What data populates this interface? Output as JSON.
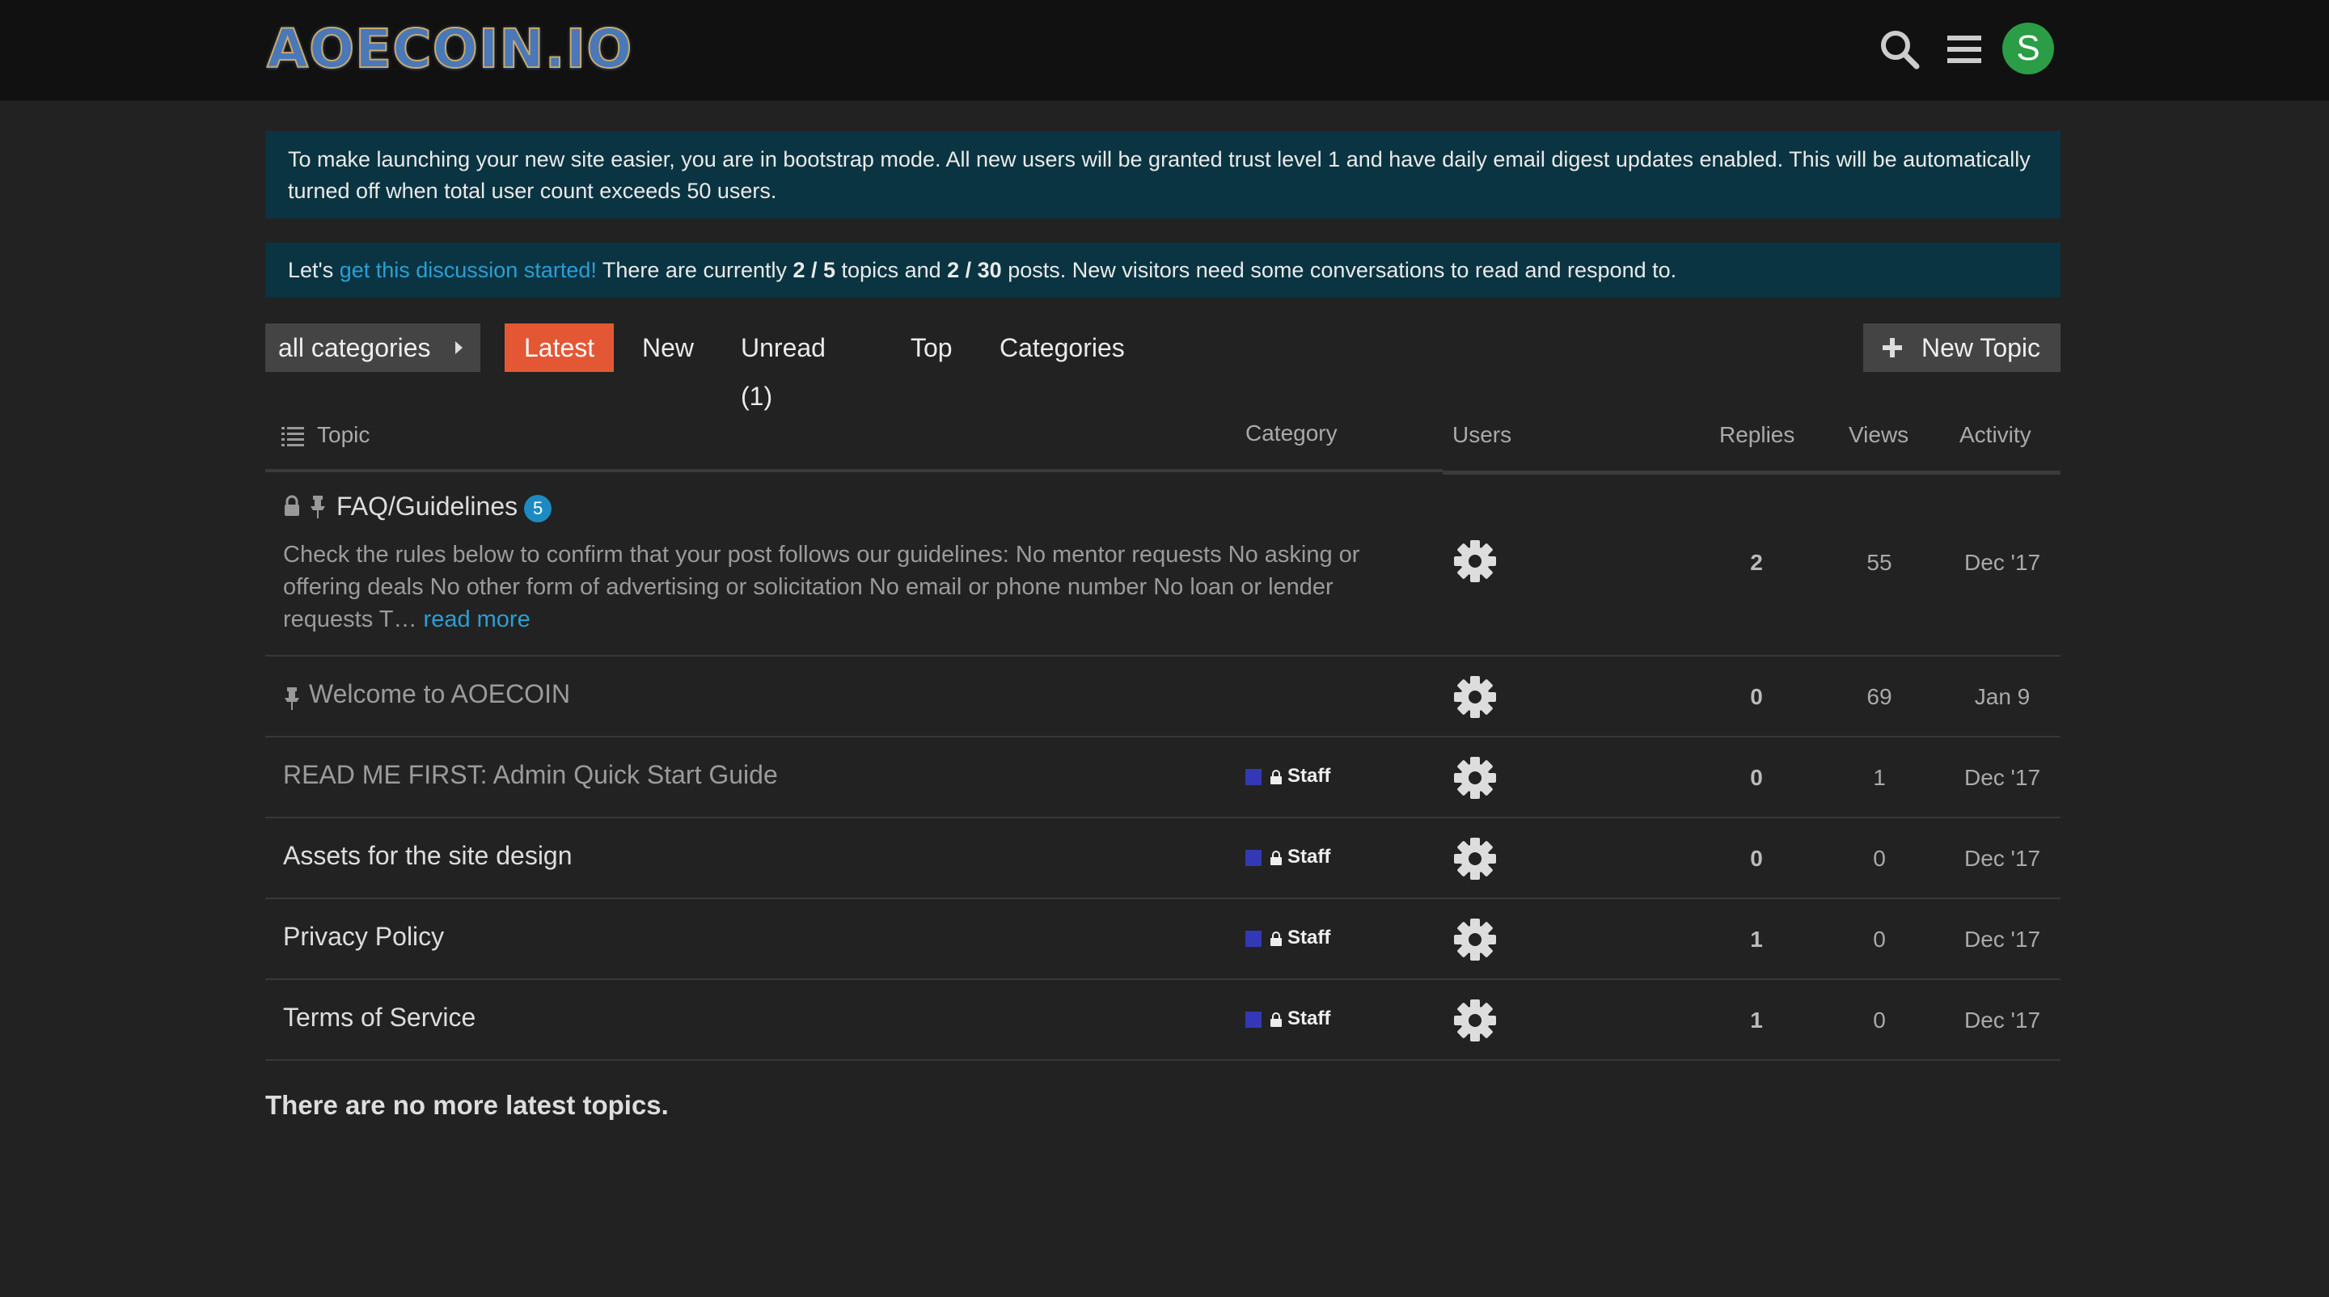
{
  "header": {
    "logo_text": "AOECOIN.IO",
    "avatar_letter": "S",
    "icons": [
      "search-icon",
      "hamburger-menu-icon"
    ]
  },
  "banners": {
    "bootstrap_notice": "To make launching your new site easier, you are in bootstrap mode. All new users will be granted trust level 1 and have daily email digest updates enabled. This will be automatically turned off when total user count exceeds 50 users.",
    "discussion": {
      "prefix": "Let's ",
      "link": "get this discussion started!",
      "text1": " There are currently ",
      "topics_count": "2 / 5",
      "text2": " topics and ",
      "posts_count": "2 / 30",
      "text3": " posts. New visitors need some conversations to read and respond to."
    }
  },
  "nav": {
    "category_dropdown": "all categories",
    "tabs": [
      "Latest",
      "New",
      "Unread (1)",
      "Top",
      "Categories"
    ],
    "active_tab": "Latest",
    "new_topic": "New Topic"
  },
  "table": {
    "headers": {
      "topic": "Topic",
      "category": "Category",
      "users": "Users",
      "replies": "Replies",
      "views": "Views",
      "activity": "Activity"
    },
    "rows": [
      {
        "title": "FAQ/Guidelines",
        "unread_count": "5",
        "excerpt": "Check the rules below to confirm that your post follows our guidelines: No mentor requests No asking or offering deals No other form of advertising or solicitation No email or phone number No loan or lender requests T…",
        "read_more": "read more",
        "category": "",
        "replies": "2",
        "views": "55",
        "activity": "Dec '17"
      },
      {
        "title": "Welcome to AOECOIN",
        "category": "",
        "replies": "0",
        "views": "69",
        "activity": "Jan 9"
      },
      {
        "title": "READ ME FIRST: Admin Quick Start Guide",
        "category": "Staff",
        "replies": "0",
        "views": "1",
        "activity": "Dec '17"
      },
      {
        "title": "Assets for the site design",
        "category": "Staff",
        "replies": "0",
        "views": "0",
        "activity": "Dec '17"
      },
      {
        "title": "Privacy Policy",
        "category": "Staff",
        "replies": "1",
        "views": "0",
        "activity": "Dec '17"
      },
      {
        "title": "Terms of Service",
        "category": "Staff",
        "replies": "1",
        "views": "0",
        "activity": "Dec '17"
      }
    ]
  },
  "footer_message": "There are no more latest topics.",
  "colors": {
    "background": "#222222",
    "header": "#111111",
    "banner": "#0a3441",
    "accent": "#e45735",
    "link": "#2a9fd6",
    "staff_category": "#3339b6",
    "avatar": "#2a9d46"
  }
}
